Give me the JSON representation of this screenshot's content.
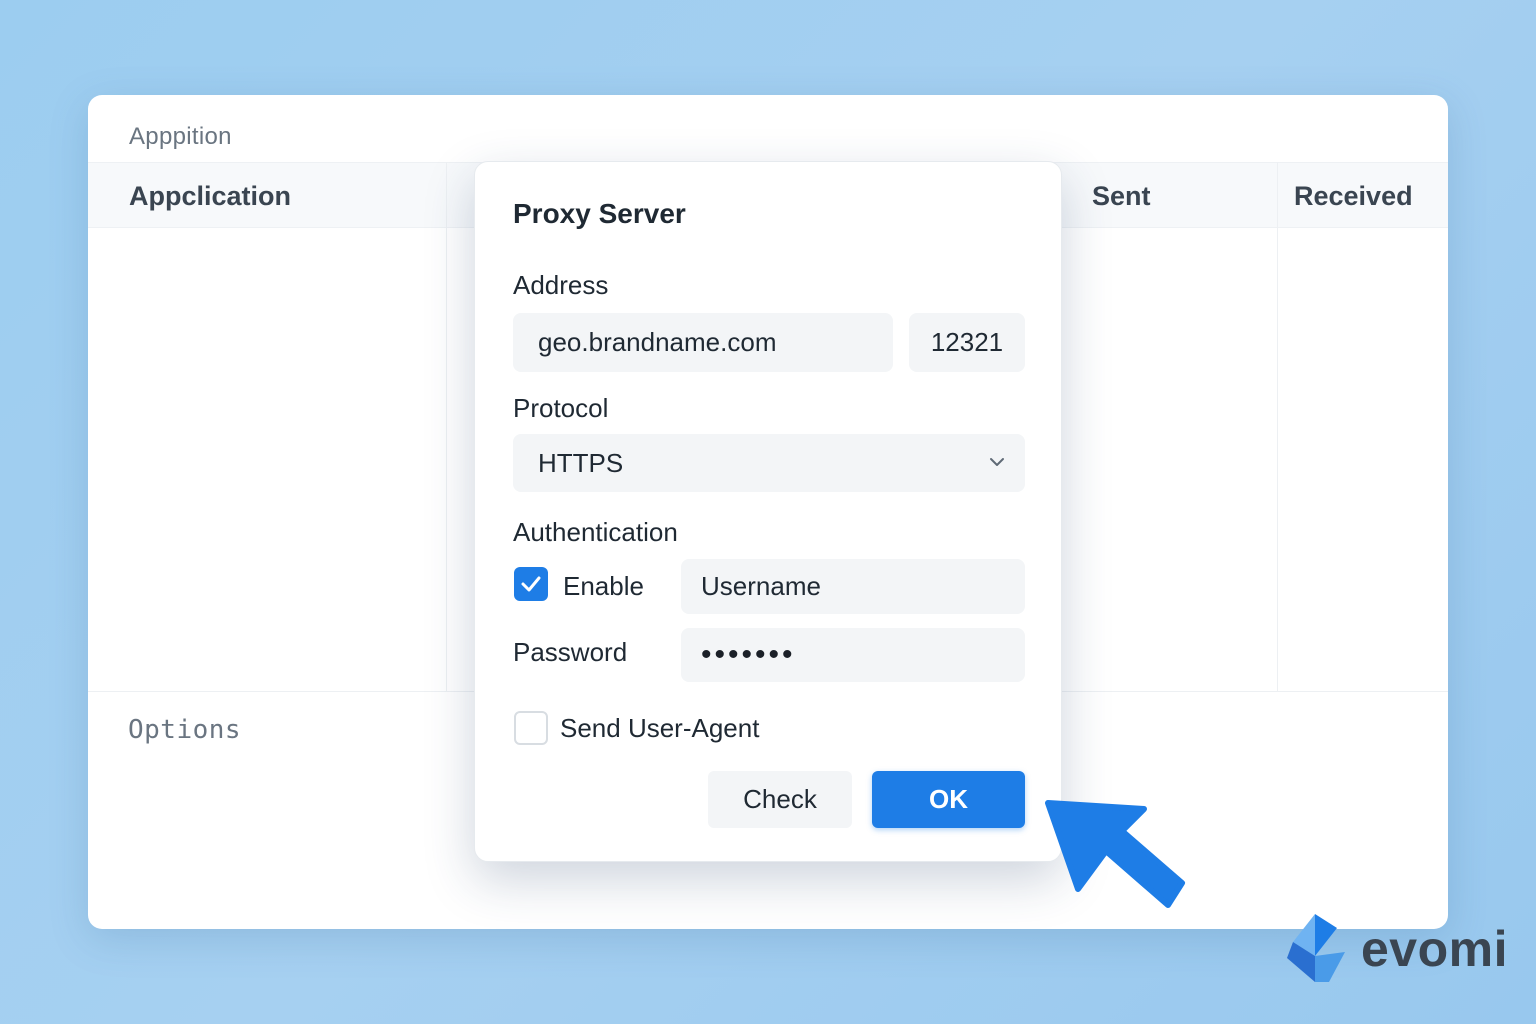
{
  "window": {
    "title": "Apppition",
    "columns": {
      "application": "Appclication",
      "sent": "Sent",
      "received": "Received"
    },
    "options_label": "Options"
  },
  "dialog": {
    "title": "Proxy Server",
    "address_label": "Address",
    "address_value": "geo.brandname.com",
    "port_value": "12321",
    "protocol_label": "Protocol",
    "protocol_value": "HTTPS",
    "auth_label": "Authentication",
    "enable_label": "Enable",
    "enable_checked": true,
    "username_value": "Username",
    "password_label": "Password",
    "password_value": "•••••••",
    "user_agent_label": "Send User-Agent",
    "user_agent_checked": false,
    "check_button": "Check",
    "ok_button": "OK"
  },
  "logo": {
    "text": "evomi"
  },
  "colors": {
    "accent": "#1e7de6",
    "background": "#9ccdf0",
    "text_muted": "#6a7581"
  },
  "icons": {
    "dropdown": "chevron-down-icon",
    "checkbox": "checkmark-icon",
    "pointer": "cursor-arrow-icon",
    "brand": "evomi-logo-icon"
  }
}
